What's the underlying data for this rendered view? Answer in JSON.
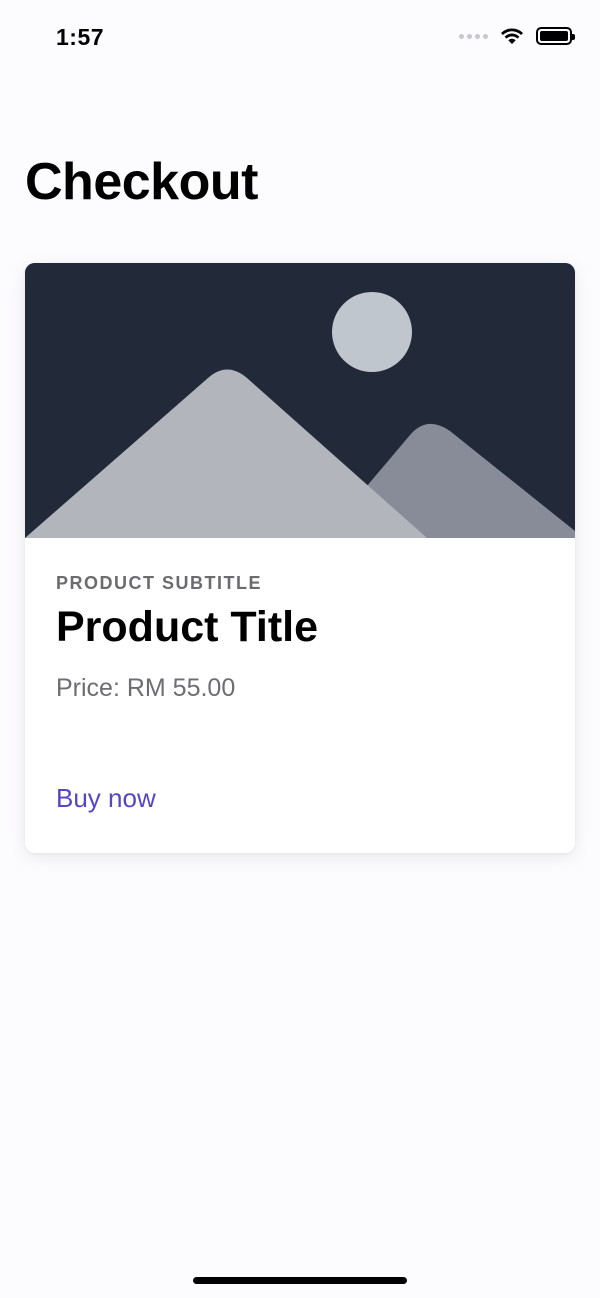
{
  "status_bar": {
    "time": "1:57",
    "icons": [
      "signal-icon",
      "wifi-icon",
      "battery-icon"
    ]
  },
  "header": {
    "title": "Checkout"
  },
  "product_card": {
    "image_icon": "image-placeholder-icon",
    "subtitle": "PRODUCT SUBTITLE",
    "title": "Product Title",
    "price": "Price: RM 55.00",
    "buy_label": "Buy now"
  },
  "colors": {
    "background": "#fcfbfe",
    "card_image_bg": "#222a3a",
    "accent": "#5546c8",
    "muted_text": "#6d6d72"
  }
}
